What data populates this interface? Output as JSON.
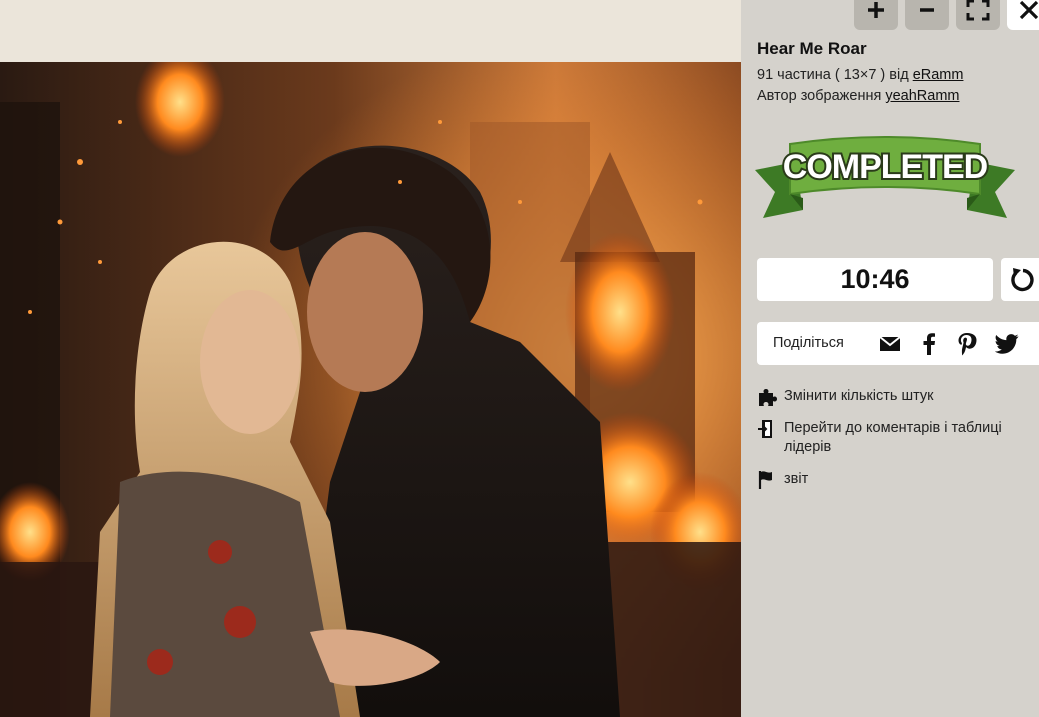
{
  "puzzle": {
    "title": "Hear Me Roar",
    "pieces_line_prefix": "91 частина ( 13×7 ) від ",
    "pieces_author": "eRamm",
    "image_author_prefix": "Автор зображення ",
    "image_author": "yeahRamm",
    "status_banner": "COMPLETED",
    "timer": "10:46"
  },
  "toolbar": {
    "icons": [
      "zoom-in-icon",
      "zoom-out-icon",
      "fullscreen-icon",
      "close-icon"
    ]
  },
  "share": {
    "label": "Поділіться",
    "icons": [
      "email-icon",
      "facebook-icon",
      "pinterest-icon",
      "twitter-icon"
    ]
  },
  "actions": [
    {
      "label": "Змінити кількість штук",
      "icon": "puzzle-piece-icon"
    },
    {
      "label": "Перейти до коментарів і таблиці лідерів",
      "icon": "door-exit-icon"
    },
    {
      "label": "звіт",
      "icon": "flag-icon"
    }
  ],
  "colors": {
    "sidebar_bg": "#d5d2cc",
    "top_strip_bg": "#ebe5da",
    "banner_green": "#6fae3f",
    "banner_dark_green": "#3d7a25"
  }
}
